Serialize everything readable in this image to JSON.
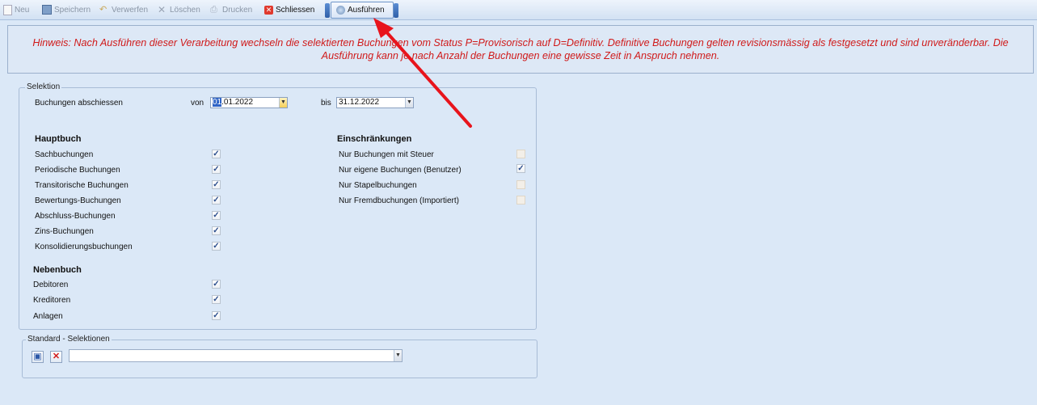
{
  "toolbar": {
    "buttons": [
      {
        "label": "Neu"
      },
      {
        "label": "Speichern"
      },
      {
        "label": "Verwerfen"
      },
      {
        "label": "Löschen"
      },
      {
        "label": "Drucken"
      },
      {
        "label": "Schliessen"
      },
      {
        "label": "Ausführen"
      }
    ]
  },
  "hint": {
    "text": "Hinweis: Nach Ausführen dieser Verarbeitung wechseln die selektierten Buchungen vom Status P=Provisorisch auf D=Definitiv. Definitive Buchungen gelten revisionsmässig als festgesetzt und sind unveränderbar. Die Ausführung kann je nach Anzahl der Buchungen eine gewisse Zeit in Anspruch nehmen."
  },
  "selection": {
    "title": "Selektion",
    "close_label": "Buchungen abschiessen",
    "from_label": "von",
    "from_value_day": "01",
    "from_value_rest": ".01.2022",
    "to_label": "bis",
    "to_value": "31.12.2022",
    "hauptbuch_title": "Hauptbuch",
    "hauptbuch_items": [
      {
        "label": "Sachbuchungen",
        "checked": true
      },
      {
        "label": "Periodische Buchungen",
        "checked": true
      },
      {
        "label": "Transitorische Buchungen",
        "checked": true
      },
      {
        "label": "Bewertungs-Buchungen",
        "checked": true
      },
      {
        "label": "Abschluss-Buchungen",
        "checked": true
      },
      {
        "label": "Zins-Buchungen",
        "checked": true
      },
      {
        "label": "Konsolidierungsbuchungen",
        "checked": true
      }
    ],
    "nebenbuch_title": "Nebenbuch",
    "nebenbuch_items": [
      {
        "label": "Debitoren",
        "checked": true
      },
      {
        "label": "Kreditoren",
        "checked": true
      },
      {
        "label": "Anlagen",
        "checked": true
      }
    ],
    "restrictions_title": "Einschränkungen",
    "restrictions_items": [
      {
        "label": "Nur Buchungen mit Steuer",
        "checked": false
      },
      {
        "label": "Nur eigene Buchungen (Benutzer)",
        "checked": true
      },
      {
        "label": "Nur Stapelbuchungen",
        "checked": false
      },
      {
        "label": "Nur Fremdbuchungen (Importiert)",
        "checked": false
      }
    ]
  },
  "standard": {
    "title": "Standard - Selektionen",
    "value": ""
  },
  "colors": {
    "hint_text": "#d01a1a",
    "arrow": "#e8141c",
    "background": "#dbe8f7"
  }
}
